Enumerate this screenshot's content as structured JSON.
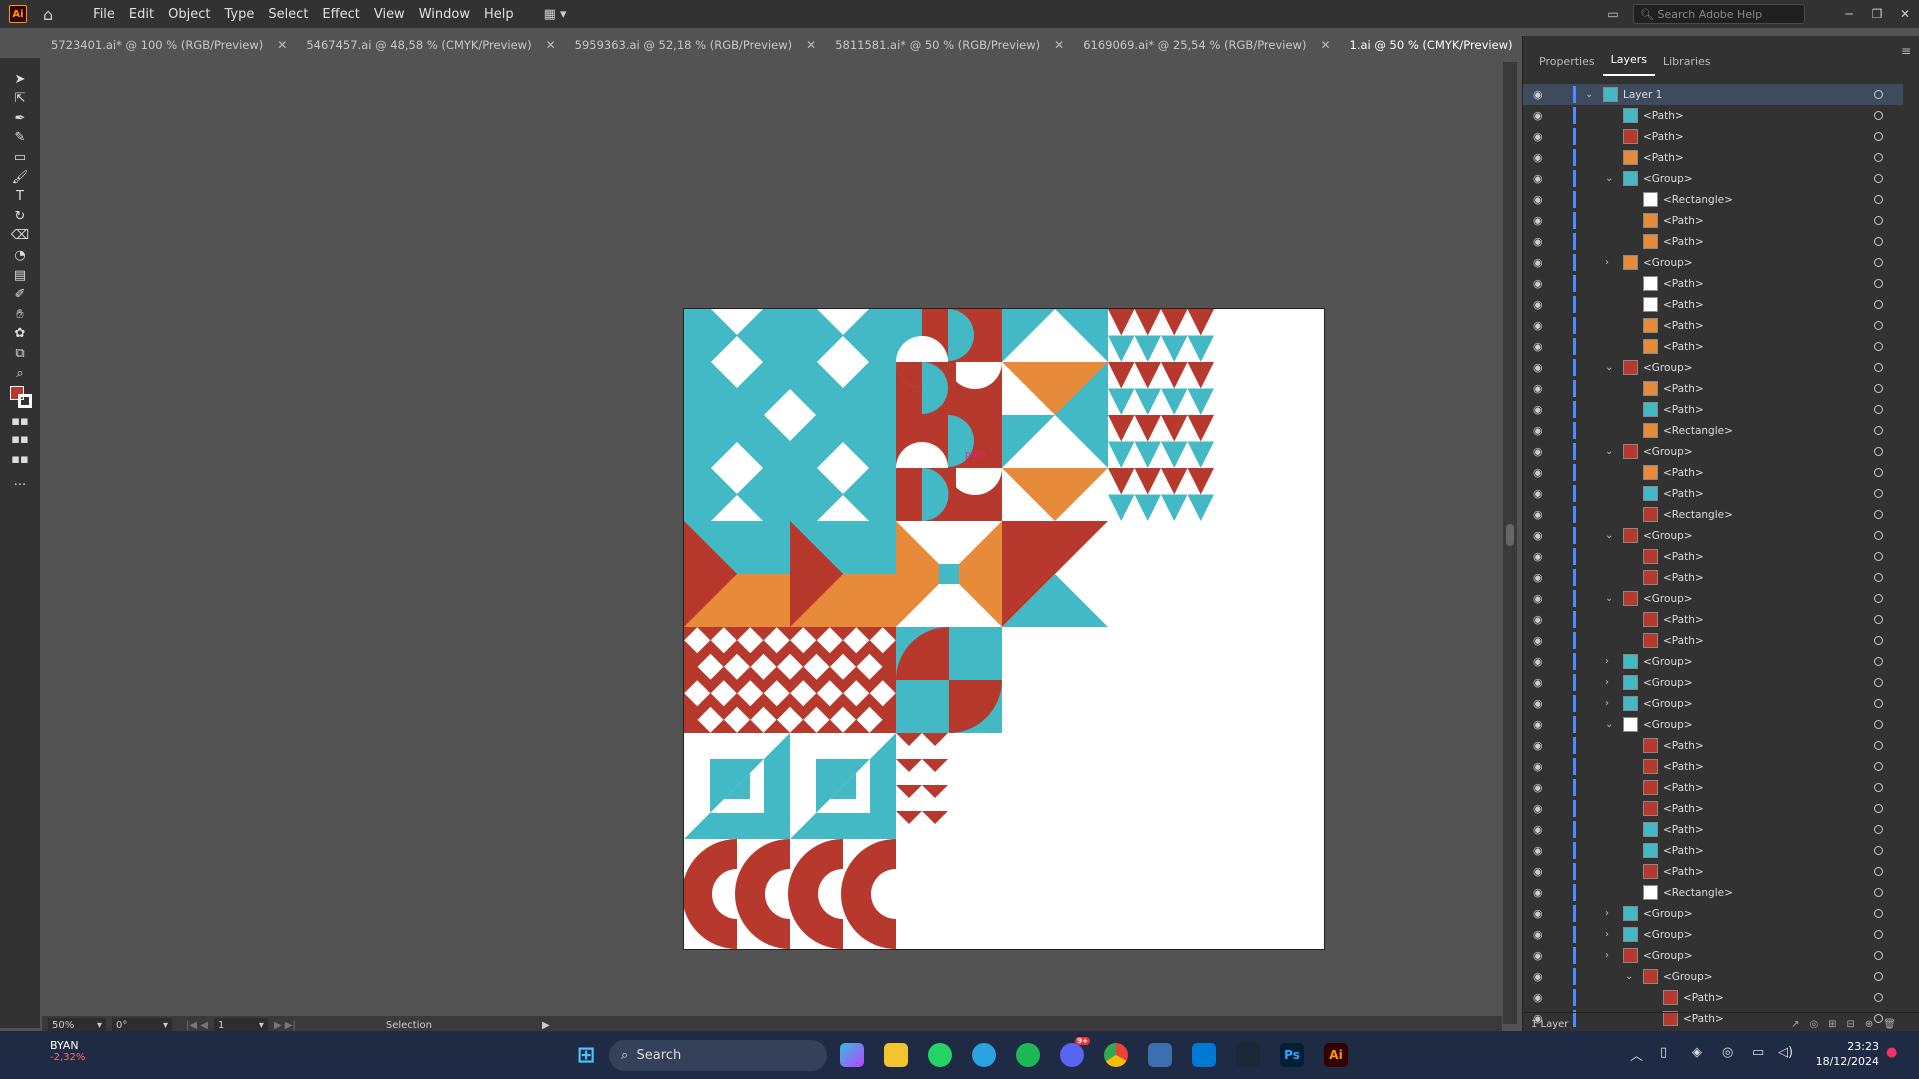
{
  "app": {
    "logo": "Ai",
    "menus": [
      "File",
      "Edit",
      "Object",
      "Type",
      "Select",
      "Effect",
      "View",
      "Window",
      "Help"
    ],
    "search_placeholder": "Search Adobe Help"
  },
  "tabs": [
    {
      "label": "5723401.ai* @ 100 % (RGB/Preview)",
      "active": false
    },
    {
      "label": "5467457.ai @ 48,58 % (CMYK/Preview)",
      "active": false
    },
    {
      "label": "5959363.ai @ 52,18 % (RGB/Preview)",
      "active": false
    },
    {
      "label": "5811581.ai* @ 50 % (RGB/Preview)",
      "active": false
    },
    {
      "label": "6169069.ai* @ 25,54 % (RGB/Preview)",
      "active": false
    },
    {
      "label": "1.ai @ 50 % (CMYK/Preview)",
      "active": true
    }
  ],
  "canvas": {
    "hover_label": "path",
    "colors": {
      "teal": "#43b9c5",
      "red": "#b7392e",
      "orange": "#e78a3a",
      "white": "#ffffff"
    }
  },
  "status": {
    "zoom": "50%",
    "rotation": "0°",
    "artboard": "1",
    "tool": "Selection"
  },
  "panel": {
    "tabs": [
      "Properties",
      "Layers",
      "Libraries"
    ],
    "active_tab": "Layers",
    "footer": "1 Layer",
    "layers": [
      {
        "name": "Layer 1",
        "caret": "down"
      },
      {
        "name": "<Path>"
      },
      {
        "name": "<Path>"
      },
      {
        "name": "<Path>"
      },
      {
        "name": "<Group>",
        "caret": "down"
      },
      {
        "name": "<Rectangle>"
      },
      {
        "name": "<Path>"
      },
      {
        "name": "<Path>"
      },
      {
        "name": "<Group>",
        "caret": "right"
      },
      {
        "name": "<Path>"
      },
      {
        "name": "<Path>"
      },
      {
        "name": "<Path>"
      },
      {
        "name": "<Path>"
      },
      {
        "name": "<Group>",
        "caret": "down"
      },
      {
        "name": "<Path>"
      },
      {
        "name": "<Path>"
      },
      {
        "name": "<Rectangle>"
      },
      {
        "name": "<Group>",
        "caret": "down"
      },
      {
        "name": "<Path>"
      },
      {
        "name": "<Path>"
      },
      {
        "name": "<Rectangle>"
      },
      {
        "name": "<Group>",
        "caret": "down"
      },
      {
        "name": "<Path>"
      },
      {
        "name": "<Path>"
      },
      {
        "name": "<Group>",
        "caret": "down"
      },
      {
        "name": "<Path>"
      },
      {
        "name": "<Path>"
      },
      {
        "name": "<Group>",
        "caret": "right"
      },
      {
        "name": "<Group>",
        "caret": "right"
      },
      {
        "name": "<Group>",
        "caret": "right"
      },
      {
        "name": "<Group>",
        "caret": "down"
      },
      {
        "name": "<Path>"
      },
      {
        "name": "<Path>"
      },
      {
        "name": "<Path>"
      },
      {
        "name": "<Path>"
      },
      {
        "name": "<Path>"
      },
      {
        "name": "<Path>"
      },
      {
        "name": "<Path>"
      },
      {
        "name": "<Rectangle>"
      },
      {
        "name": "<Group>",
        "caret": "right"
      },
      {
        "name": "<Group>",
        "caret": "right"
      },
      {
        "name": "<Group>",
        "caret": "right"
      },
      {
        "name": "<Group>",
        "caret": "down"
      },
      {
        "name": "<Path>"
      },
      {
        "name": "<Path>"
      }
    ]
  },
  "taskbar": {
    "weather_title": "BYAN",
    "weather_sub": "-2,32%",
    "search": "Search",
    "time": "23:23",
    "date": "18/12/2024",
    "badge": "9+"
  }
}
